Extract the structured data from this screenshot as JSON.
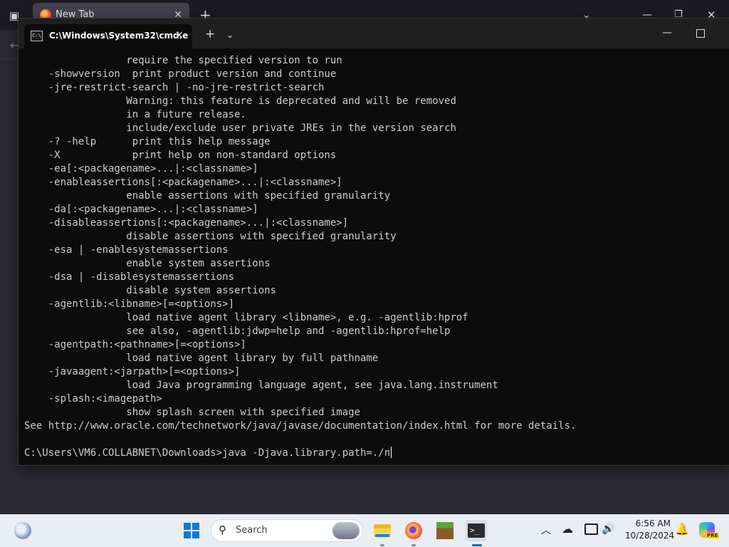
{
  "browser": {
    "tab_title": "New Tab",
    "new_tab": "+",
    "list_all_tabs": "⌄",
    "minimize": "—",
    "maximize": "❐",
    "close": "✕",
    "back": "←",
    "list_tabs_icon": "▣",
    "tab_close": "✕"
  },
  "terminal": {
    "tab_title": "C:\\Windows\\System32\\cmd.e",
    "tab_icon_text": "C:\\",
    "tab_close": "✕",
    "new_tab": "+",
    "dropdown": "⌄",
    "minimize": "—",
    "lines": [
      "                 require the specified version to run",
      "    -showversion  print product version and continue",
      "    -jre-restrict-search | -no-jre-restrict-search",
      "                 Warning: this feature is deprecated and will be removed",
      "                 in a future release.",
      "                 include/exclude user private JREs in the version search",
      "    -? -help      print this help message",
      "    -X            print help on non-standard options",
      "    -ea[:<packagename>...|:<classname>]",
      "    -enableassertions[:<packagename>...|:<classname>]",
      "                 enable assertions with specified granularity",
      "    -da[:<packagename>...|:<classname>]",
      "    -disableassertions[:<packagename>...|:<classname>]",
      "                 disable assertions with specified granularity",
      "    -esa | -enablesystemassertions",
      "                 enable system assertions",
      "    -dsa | -disablesystemassertions",
      "                 disable system assertions",
      "    -agentlib:<libname>[=<options>]",
      "                 load native agent library <libname>, e.g. -agentlib:hprof",
      "                 see also, -agentlib:jdwp=help and -agentlib:hprof=help",
      "    -agentpath:<pathname>[=<options>]",
      "                 load native agent library by full pathname",
      "    -javaagent:<jarpath>[=<options>]",
      "                 load Java programming language agent, see java.lang.instrument",
      "    -splash:<imagepath>",
      "                 show splash screen with specified image",
      "See http://www.oracle.com/technetwork/java/javase/documentation/index.html for more details.",
      "",
      "C:\\Users\\VM6.COLLABNET\\Downloads>java -Djava.library.path=./n"
    ]
  },
  "taskbar": {
    "search_label": "Search",
    "search_icon": "⚲",
    "tray_chevron": "︿",
    "cloud_icon": "☁",
    "volume_icon": "🔊",
    "time": "6:56 AM",
    "date": "10/28/2024",
    "bell_icon": "🔔",
    "copilot_badge": "PRE",
    "terminal_app_text": ">_"
  }
}
